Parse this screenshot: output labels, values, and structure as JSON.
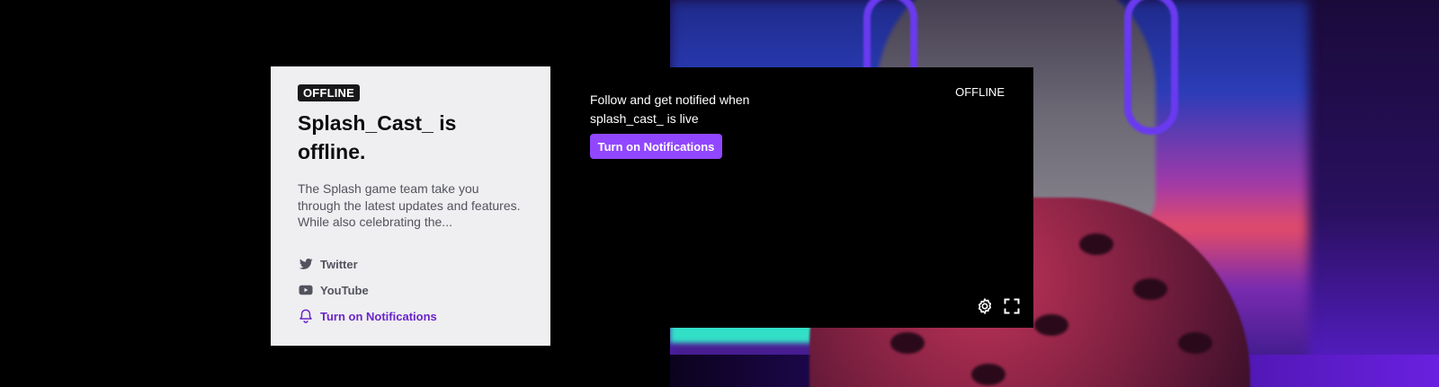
{
  "card": {
    "badge": "OFFLINE",
    "title": "Splash_Cast_ is offline.",
    "description": "The Splash game team take you through the latest updates and features. While also celebrating the...",
    "links": [
      {
        "label": "Twitter",
        "icon": "twitter-icon"
      },
      {
        "label": "YouTube",
        "icon": "youtube-icon"
      },
      {
        "label": "Turn on Notifications",
        "icon": "bell-icon"
      }
    ]
  },
  "player": {
    "follow_text": "Follow and get notified when splash_cast_ is live",
    "status": "OFFLINE",
    "button_label": "Turn on Notifications",
    "controls": [
      "gear-icon",
      "fullscreen-icon"
    ]
  },
  "colors": {
    "accent": "#9147ff",
    "link_accent": "#6a25c9",
    "card_bg": "#efeff1",
    "badge_bg": "#18181b"
  }
}
